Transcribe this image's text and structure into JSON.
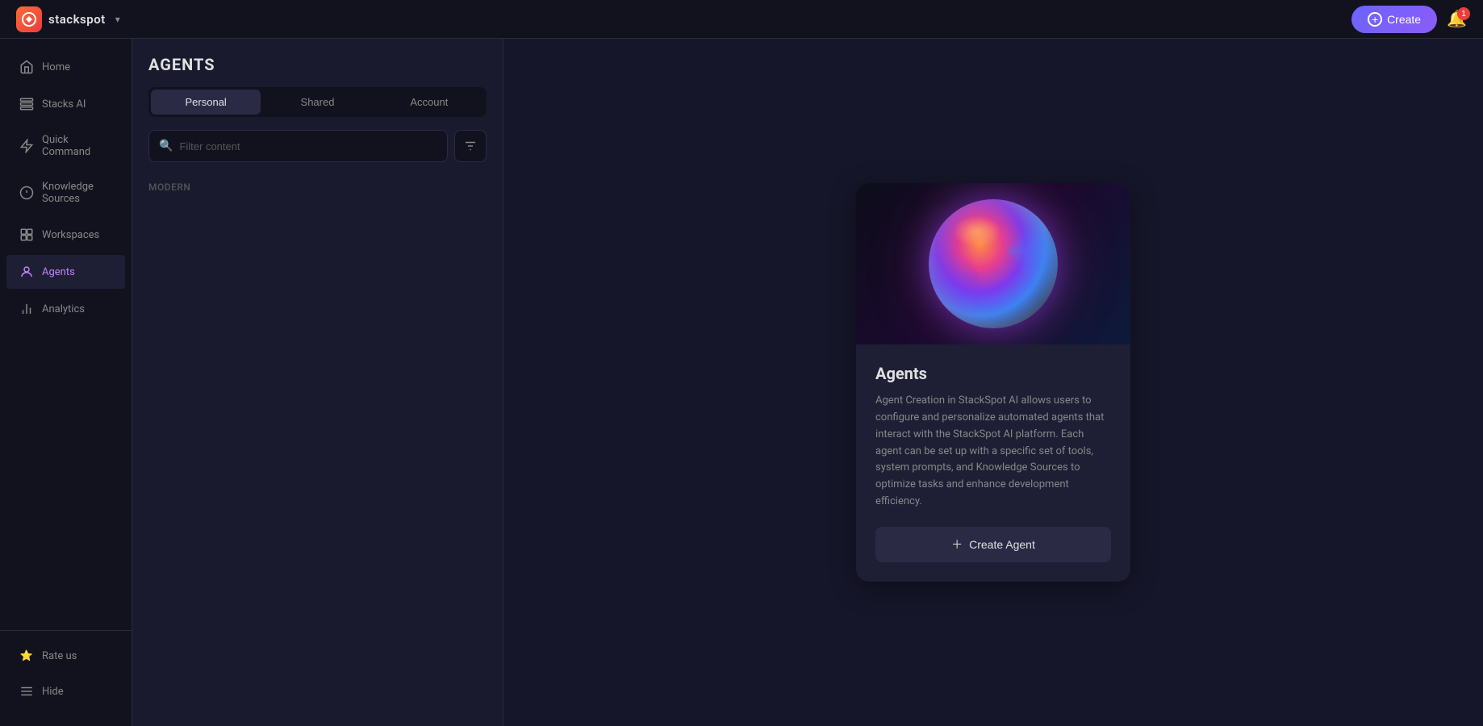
{
  "app": {
    "logo_text": "stackspot",
    "logo_abbr": "S",
    "chevron": "▾"
  },
  "topbar": {
    "create_label": "Create",
    "notification_count": "1"
  },
  "sidebar": {
    "items": [
      {
        "id": "home",
        "label": "Home",
        "icon": "home-icon",
        "active": false
      },
      {
        "id": "stacks-ai",
        "label": "Stacks AI",
        "icon": "stacks-icon",
        "active": false
      },
      {
        "id": "quick-command",
        "label": "Quick Command",
        "icon": "quick-command-icon",
        "active": false
      },
      {
        "id": "knowledge-sources",
        "label": "Knowledge Sources",
        "icon": "knowledge-icon",
        "active": false
      },
      {
        "id": "workspaces",
        "label": "Workspaces",
        "icon": "workspaces-icon",
        "active": false
      },
      {
        "id": "agents",
        "label": "Agents",
        "icon": "agents-icon",
        "active": true
      },
      {
        "id": "analytics",
        "label": "Analytics",
        "icon": "analytics-icon",
        "active": false
      }
    ],
    "bottom": [
      {
        "id": "rate-us",
        "label": "Rate us",
        "icon": "star-icon"
      },
      {
        "id": "hide",
        "label": "Hide",
        "icon": "hide-icon"
      }
    ]
  },
  "agents": {
    "section_title": "AGENTS",
    "tabs": [
      {
        "id": "personal",
        "label": "Personal",
        "active": true
      },
      {
        "id": "shared",
        "label": "Shared",
        "active": false
      },
      {
        "id": "account",
        "label": "Account",
        "active": false
      }
    ],
    "search_placeholder": "Filter content",
    "section_modern": "Modern"
  },
  "info_card": {
    "title": "Agents",
    "description": "Agent Creation in StackSpot AI allows users to configure and personalize automated agents that interact with the StackSpot AI platform. Each agent can be set up with a specific set of tools, system prompts, and Knowledge Sources to optimize tasks and enhance development efficiency.",
    "create_button_label": "Create Agent",
    "image_alt": "agent-orb-visual"
  }
}
